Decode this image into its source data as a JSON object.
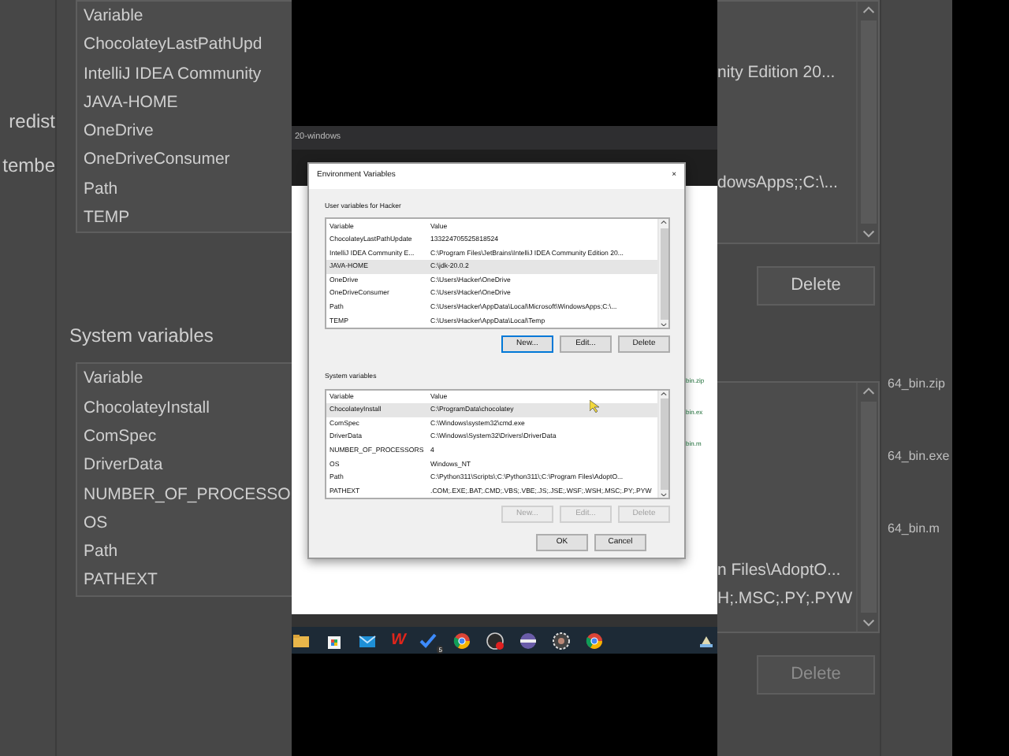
{
  "side_left": {
    "fragments": [
      "redist",
      "tembe"
    ],
    "user_list": {
      "header": "Variable",
      "rows": [
        "ChocolateyLastPathUpd",
        "IntelliJ IDEA Community",
        "JAVA-HOME",
        "OneDrive",
        "OneDriveConsumer",
        "Path",
        "TEMP"
      ]
    },
    "system_label": "System variables",
    "system_list": {
      "header": "Variable",
      "rows": [
        "ChocolateyInstall",
        "ComSpec",
        "DriverData",
        "NUMBER_OF_PROCESSO",
        "OS",
        "Path",
        "PATHEXT"
      ]
    }
  },
  "browser": {
    "tab_title": "20-windows"
  },
  "dialog": {
    "title": "Environment Variables",
    "close": "×",
    "user_group": {
      "label": "User variables for Hacker",
      "columns": [
        "Variable",
        "Value"
      ],
      "rows": [
        {
          "name": "ChocolateyLastPathUpdate",
          "value": "133224705525818524",
          "selected": false
        },
        {
          "name": "IntelliJ IDEA Community E...",
          "value": "C:\\Program Files\\JetBrains\\IntelliJ IDEA Community Edition 20...",
          "selected": false
        },
        {
          "name": "JAVA-HOME",
          "value": "C:\\jdk-20.0.2",
          "selected": true
        },
        {
          "name": "OneDrive",
          "value": "C:\\Users\\Hacker\\OneDrive",
          "selected": false
        },
        {
          "name": "OneDriveConsumer",
          "value": "C:\\Users\\Hacker\\OneDrive",
          "selected": false
        },
        {
          "name": "Path",
          "value": "C:\\Users\\Hacker\\AppData\\Local\\Microsoft\\WindowsApps;C:\\...",
          "selected": false
        },
        {
          "name": "TEMP",
          "value": "C:\\Users\\Hacker\\AppData\\Local\\Temp",
          "selected": false
        }
      ],
      "buttons": [
        {
          "label": "New...",
          "disabled": false,
          "focused": true
        },
        {
          "label": "Edit...",
          "disabled": false,
          "focused": false
        },
        {
          "label": "Delete",
          "disabled": false,
          "focused": false
        }
      ]
    },
    "system_group": {
      "label": "System variables",
      "columns": [
        "Variable",
        "Value"
      ],
      "rows": [
        {
          "name": "ChocolateyInstall",
          "value": "C:\\ProgramData\\chocolatey",
          "selected": true
        },
        {
          "name": "ComSpec",
          "value": "C:\\Windows\\system32\\cmd.exe",
          "selected": false
        },
        {
          "name": "DriverData",
          "value": "C:\\Windows\\System32\\Drivers\\DriverData",
          "selected": false
        },
        {
          "name": "NUMBER_OF_PROCESSORS",
          "value": "4",
          "selected": false
        },
        {
          "name": "OS",
          "value": "Windows_NT",
          "selected": false
        },
        {
          "name": "Path",
          "value": "C:\\Python311\\Scripts\\;C:\\Python311\\;C:\\Program Files\\AdoptO...",
          "selected": false
        },
        {
          "name": "PATHEXT",
          "value": ".COM;.EXE;.BAT;.CMD;.VBS;.VBE;.JS;.JSE;.WSF;.WSH;.MSC;.PY;.PYW",
          "selected": false
        }
      ],
      "buttons": [
        {
          "label": "New...",
          "disabled": true
        },
        {
          "label": "Edit...",
          "disabled": true
        },
        {
          "label": "Delete",
          "disabled": true
        }
      ]
    },
    "buttons": [
      {
        "label": "OK"
      },
      {
        "label": "Cancel"
      }
    ]
  },
  "page_links": [
    "bin.zip",
    "bin.ex",
    "bin.m"
  ],
  "taskbar": {
    "icons": [
      {
        "kind": "folder"
      },
      {
        "kind": "bag"
      },
      {
        "kind": "mail"
      },
      {
        "kind": "letter",
        "label": "W"
      },
      {
        "kind": "check",
        "label": "5"
      },
      {
        "kind": "browser"
      },
      {
        "kind": "dial"
      },
      {
        "kind": "pill"
      },
      {
        "kind": "gear"
      },
      {
        "kind": "browser"
      }
    ]
  },
  "side_right": {
    "user_values": [
      "nity Edition 20...",
      "dowsApps;;C:\\..."
    ],
    "delete_button": {
      "label": "Delete",
      "disabled": false
    },
    "system_values": [
      "n Files\\AdoptO...",
      "H;.MSC;.PY;.PYW"
    ],
    "delete_button_2": {
      "label": "Delete",
      "disabled": true
    },
    "file_links": [
      "64_bin.zip",
      "64_bin.exe",
      "64_bin.m"
    ]
  }
}
